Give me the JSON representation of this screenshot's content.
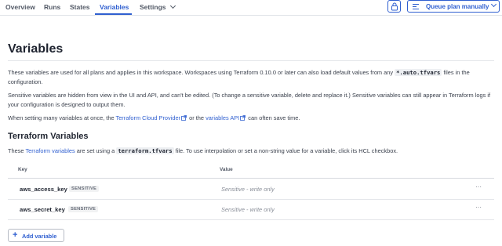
{
  "nav": {
    "tabs": [
      {
        "label": "Overview"
      },
      {
        "label": "Runs"
      },
      {
        "label": "States"
      },
      {
        "label": "Variables"
      },
      {
        "label": "Settings"
      }
    ],
    "active_tab": "Variables",
    "queue_button": "Queue plan manually"
  },
  "page": {
    "title": "Variables",
    "intro": {
      "p1_a": "These variables are used for all plans and applies in this workspace. Workspaces using Terraform 0.10.0 or later can also load default values from any",
      "p1_code": "*.auto.tfvars",
      "p1_b": "files in the configuration.",
      "p2": "Sensitive variables are hidden from view in the UI and API, and can't be edited. (To change a sensitive variable, delete and replace it.) Sensitive variables can still appear in Terraform logs if your configuration is designed to output them.",
      "p3_a": "When setting many variables at once, the",
      "p3_link1": "Terraform Cloud Provider",
      "p3_b": "or the",
      "p3_link2": "variables API",
      "p3_c": "can often save time."
    }
  },
  "terraform_vars": {
    "title": "Terraform Variables",
    "desc_a": "These",
    "desc_link": "Terraform variables",
    "desc_b": "are set using a",
    "desc_code": "terraform.tfvars",
    "desc_c": "file. To use interpolation or set a non-string value for a variable, click its HCL checkbox.",
    "columns": {
      "key": "Key",
      "value": "Value"
    },
    "rows": [
      {
        "key": "aws_access_key",
        "badge": "SENSITIVE",
        "value": "Sensitive - write only",
        "more": "···"
      },
      {
        "key": "aws_secret_key",
        "badge": "SENSITIVE",
        "value": "Sensitive - write only",
        "more": "···"
      }
    ],
    "add_button": "Add variable"
  },
  "colors": {
    "accent": "#2f5fd0",
    "text": "#1f2430",
    "muted": "#8a8f99",
    "border": "#dfe2e7"
  },
  "icons": {
    "lock": "lock-icon",
    "queue": "queue-list-icon",
    "external": "external-link-icon",
    "add": "plus-icon",
    "more": "more-horizontal-icon"
  }
}
